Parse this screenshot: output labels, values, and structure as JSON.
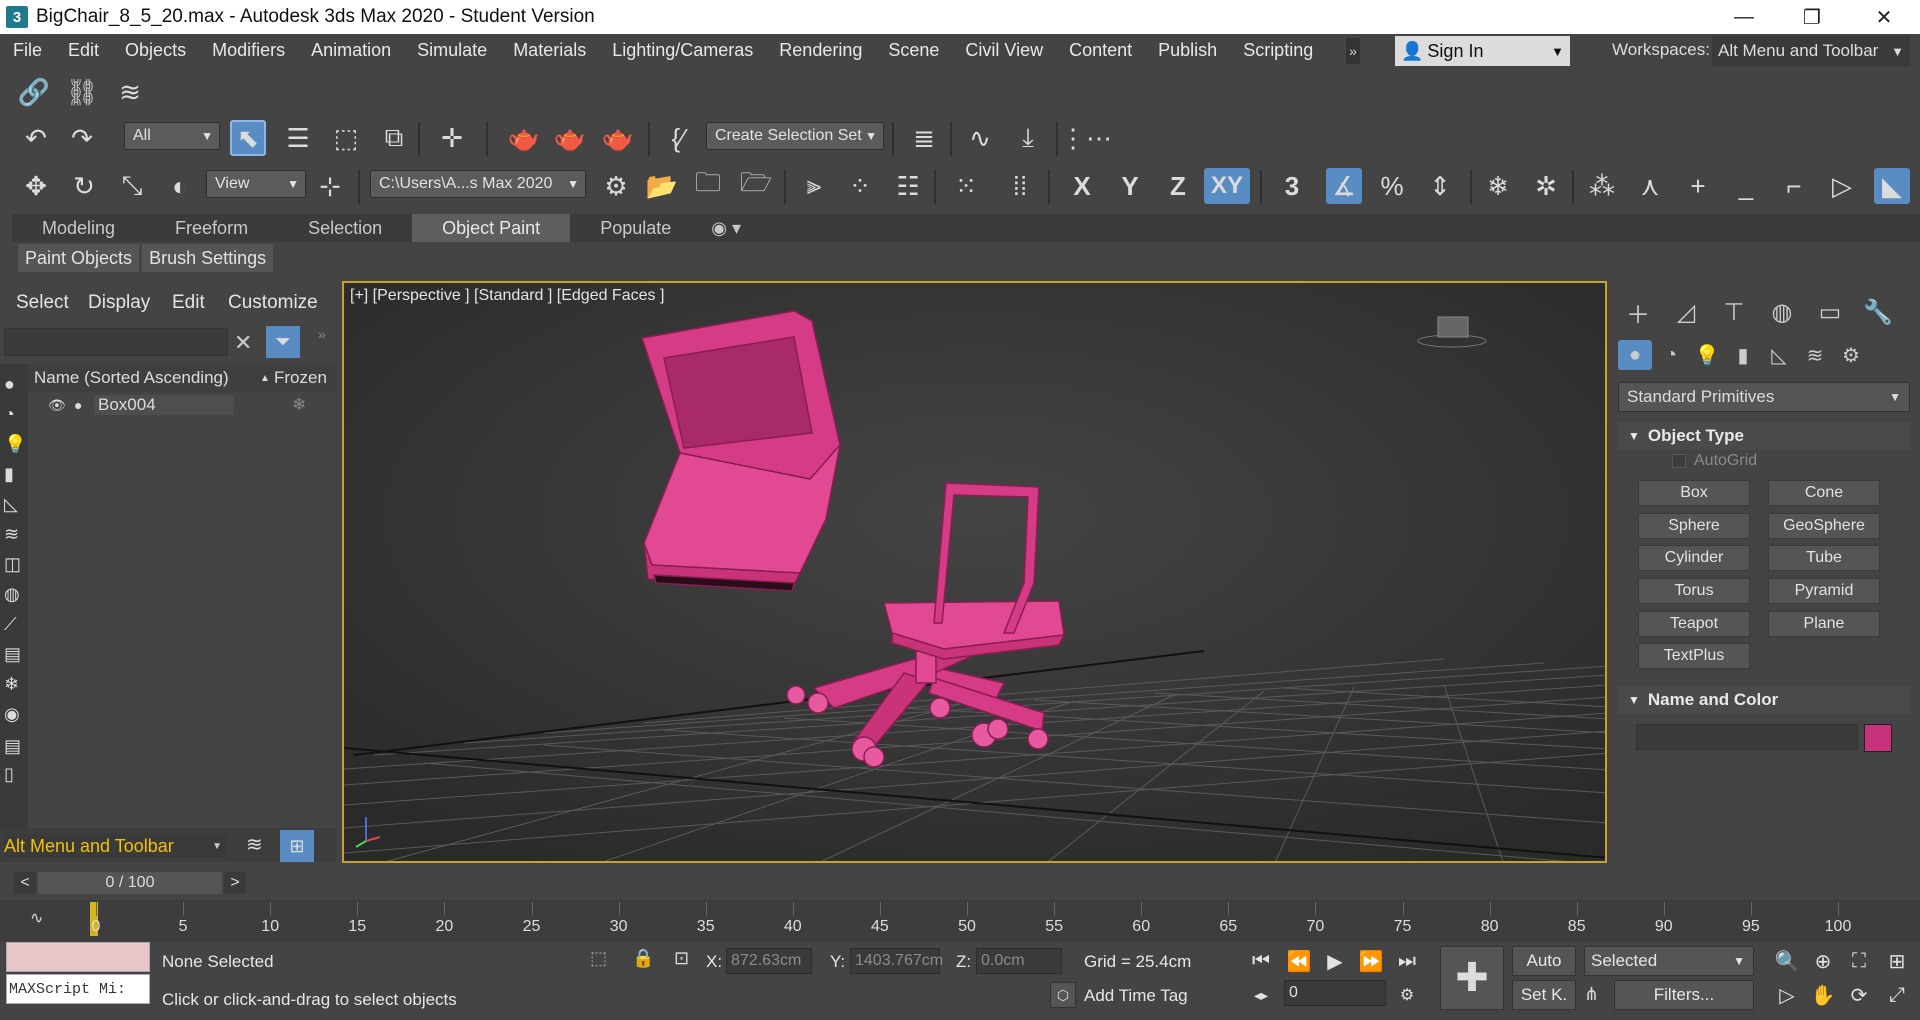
{
  "window": {
    "app_icon": "3",
    "title": "BigChair_8_5_20.max - Autodesk 3ds Max 2020 - Student Version",
    "minimize": "—",
    "restore": "❐",
    "close": "✕"
  },
  "menubar": {
    "items": [
      "File",
      "Edit",
      "Objects",
      "Modifiers",
      "Animation",
      "Simulate",
      "Materials",
      "Lighting/Cameras",
      "Rendering",
      "Scene",
      "Civil View",
      "Content",
      "Publish",
      "Scripting"
    ],
    "overflow": "»",
    "sign_in": "Sign In",
    "workspaces_label": "Workspaces:",
    "workspace_value": "Alt Menu and Toolbar"
  },
  "toolbar": {
    "selection_filter": "All",
    "selection_set": "Create Selection Set",
    "ref_coord": "View",
    "project_path": "C:\\Users\\A...s Max 2020",
    "axis_x": "X",
    "axis_y": "Y",
    "axis_z": "Z",
    "axis_xy": "XY",
    "snap_3": "3"
  },
  "ribbon": {
    "tabs": [
      "Modeling",
      "Freeform",
      "Selection",
      "Object Paint",
      "Populate"
    ],
    "active_tab": "Object Paint",
    "subtabs": [
      "Paint Objects",
      "Brush Settings"
    ]
  },
  "explorer": {
    "menus": [
      "Select",
      "Display",
      "Edit",
      "Customize"
    ],
    "column_name": "Name (Sorted Ascending)",
    "sort_arrow": "▲",
    "column_frozen": "Frozen",
    "rows": [
      {
        "name": "Box004"
      }
    ],
    "workspace_label": "Alt Menu and Toolbar"
  },
  "viewport": {
    "label": "[+] [Perspective ] [Standard ] [Edged Faces ]",
    "object_color": "#d63c86"
  },
  "command_panel": {
    "category": "Standard Primitives",
    "rollout_object_type": "Object Type",
    "autogrid": "AutoGrid",
    "primitives": [
      "Box",
      "Cone",
      "Sphere",
      "GeoSphere",
      "Cylinder",
      "Tube",
      "Torus",
      "Pyramid",
      "Teapot",
      "Plane",
      "TextPlus"
    ],
    "rollout_name_color": "Name and Color",
    "swatch_color": "#c8327a"
  },
  "timeline": {
    "frame_display": "0 / 100",
    "prev": "<",
    "next": ">",
    "ticks": [
      "0",
      "5",
      "10",
      "15",
      "20",
      "25",
      "30",
      "35",
      "40",
      "45",
      "50",
      "55",
      "60",
      "65",
      "70",
      "75",
      "80",
      "85",
      "90",
      "95",
      "100"
    ]
  },
  "status": {
    "maxscript": "MAXScript Mi:",
    "selection": "None Selected",
    "prompt": "Click or click-and-drag to select objects",
    "x_label": "X:",
    "x_value": "872.63cm",
    "y_label": "Y:",
    "y_value": "1403.767cm",
    "z_label": "Z:",
    "z_value": "0.0cm",
    "grid": "Grid = 25.4cm",
    "add_time_tag": "Add Time Tag",
    "auto": "Auto",
    "set_key": "Set K.",
    "key_mode": "Selected",
    "filters": "Filters...",
    "frame_field": "0"
  }
}
